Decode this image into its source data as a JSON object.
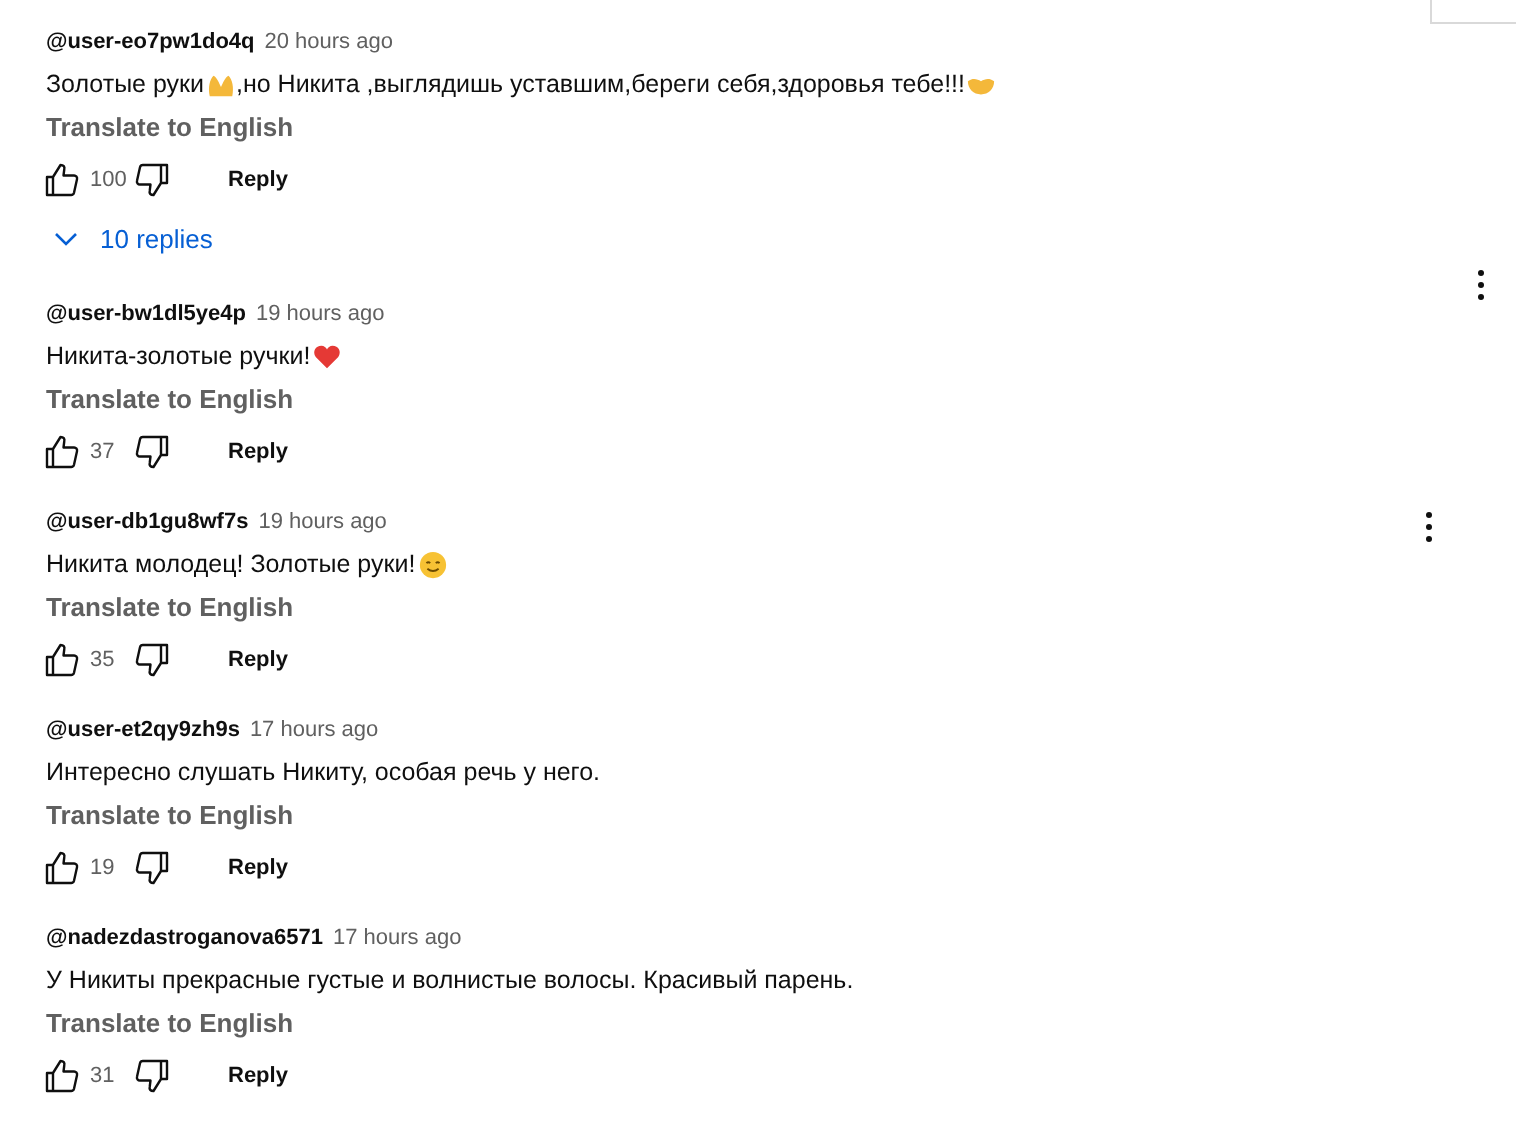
{
  "comments": [
    {
      "author": "@user-eo7pw1do4q",
      "time": "20 hours ago",
      "parts": [
        {
          "kind": "text",
          "value": "Золотые руки"
        },
        {
          "kind": "hands"
        },
        {
          "kind": "text",
          "value": ",но Никита ,выглядишь уставшим,береги себя,здоровья тебе!!!"
        },
        {
          "kind": "handshake"
        }
      ],
      "translate": "Translate to English",
      "likes": "100",
      "reply": "Reply",
      "replies": "10 replies",
      "menu": false
    },
    {
      "author": "@user-bw1dl5ye4p",
      "time": "19 hours ago",
      "parts": [
        {
          "kind": "text",
          "value": "Никита-золотые ручки!"
        },
        {
          "kind": "heart"
        }
      ],
      "translate": "Translate to English",
      "likes": "37",
      "reply": "Reply",
      "menu": true
    },
    {
      "author": "@user-db1gu8wf7s",
      "time": "19 hours ago",
      "parts": [
        {
          "kind": "text",
          "value": "Никита молодец! Золотые руки!"
        },
        {
          "kind": "smile"
        }
      ],
      "translate": "Translate to English",
      "likes": "35",
      "reply": "Reply",
      "menu": true
    },
    {
      "author": "@user-et2qy9zh9s",
      "time": "17 hours ago",
      "parts": [
        {
          "kind": "text",
          "value": "Интересно слушать Никиту, особая речь у него."
        }
      ],
      "translate": "Translate to English",
      "likes": "19",
      "reply": "Reply",
      "menu": false
    },
    {
      "author": "@nadezdastroganova6571",
      "time": "17 hours ago",
      "parts": [
        {
          "kind": "text",
          "value": "У Никиты прекрасные густые и волнистые волосы. Красивый парень."
        }
      ],
      "translate": "Translate to English",
      "likes": "31",
      "reply": "Reply",
      "menu": false
    }
  ]
}
